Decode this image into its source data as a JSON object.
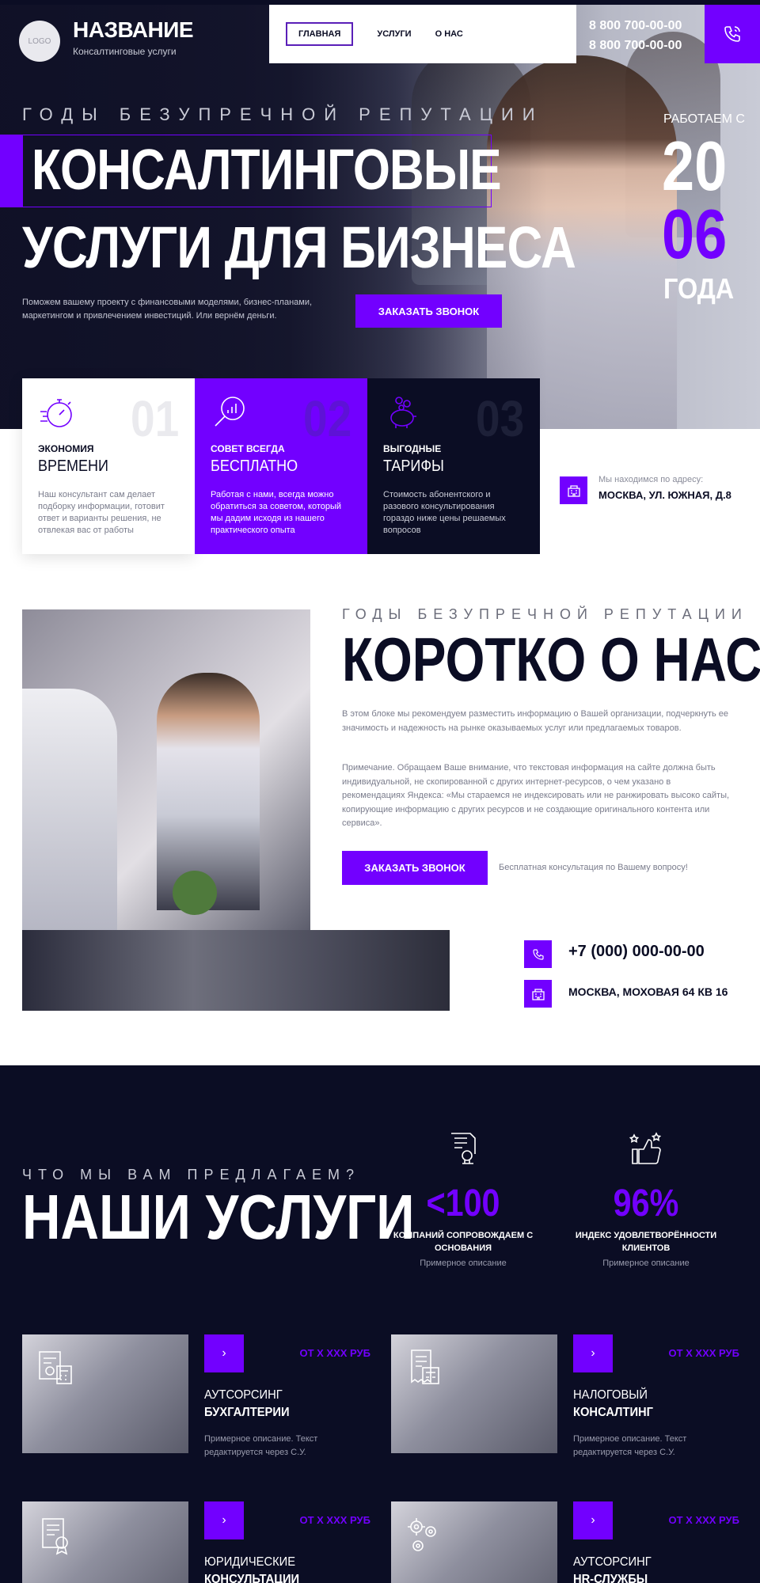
{
  "header": {
    "logo_text": "LOGO",
    "brand_name": "НАЗВАНИЕ",
    "brand_sub": "Консалтинговые услуги",
    "nav": [
      "ГЛАВНАЯ",
      "УСЛУГИ",
      "О НАС"
    ],
    "phone1": "8 800 700-00-00",
    "phone2": "8 800 700-00-00"
  },
  "hero": {
    "tagline": "ГОДЫ БЕЗУПРЕЧНОЙ РЕПУТАЦИИ",
    "headline1": "КОНСАЛТИНГОВЫЕ",
    "headline2": "УСЛУГИ ДЛЯ БИЗНЕСА",
    "description": "Поможем вашему проекту с финансовыми моделями, бизнес-планами, маркетингом и привлечением инвестиций. Или вернём деньги.",
    "cta": "ЗАКАЗАТЬ ЗВОНОК",
    "since_label": "РАБОТАЕМ С",
    "since_year_1": "20",
    "since_year_2": "06",
    "since_word": "ГОДА"
  },
  "features": [
    {
      "num": "01",
      "title1": "ЭКОНОМИЯ",
      "title2": "ВРЕМЕНИ",
      "text": "Наш консультант сам делает подборку информации, готовит ответ и варианты решения, не отвлекая вас от работы",
      "icon": "stopwatch-icon"
    },
    {
      "num": "02",
      "title1": "СОВЕТ ВСЕГДА",
      "title2": "БЕСПЛАТНО",
      "text": "Работая с нами, всегда можно обратиться за советом, который мы дадим исходя из нашего практического опыта",
      "icon": "magnifier-chart-icon"
    },
    {
      "num": "03",
      "title1": "ВЫГОДНЫЕ",
      "title2": "ТАРИФЫ",
      "text": "Стоимость абонентского и разового консультирования гораздо ниже цены решаемых вопросов",
      "icon": "piggy-bank-icon"
    }
  ],
  "address": {
    "label": "Мы находимся по адресу:",
    "value": "МОСКВА, УЛ. ЮЖНАЯ, Д.8"
  },
  "about": {
    "tagline": "ГОДЫ БЕЗУПРЕЧНОЙ РЕПУТАЦИИ",
    "title": "КОРОТКО О НАС",
    "p1": "В этом блоке мы рекомендуем разместить информацию о Вашей организации, подчеркнуть ее значимость и надежность на рынке оказываемых услуг или предлагаемых товаров.",
    "p2": "Примечание. Обращаем Ваше внимание, что текстовая информация на сайте должна быть индивидуальной, не скопированной с других интернет-ресурсов, о чем указано в рекомендациях Яндекса: «Мы стараемся не индексировать или не ранжировать высоко сайты, копирующие информацию с других ресурсов и не создающие оригинального контента или сервиса».",
    "cta": "ЗАКАЗАТЬ ЗВОНОК",
    "note": "Бесплатная консультация по Вашему вопросу!",
    "phone": "+7 (000) 000-00-00",
    "addr": "МОСКВА, МОХОВАЯ 64 КВ 16"
  },
  "services": {
    "tagline": "ЧТО МЫ ВАМ ПРЕДЛАГАЕМ?",
    "title": "НАШИ УСЛУГИ",
    "stats": [
      {
        "value": "<100",
        "label": "КОМПАНИЙ СОПРОВОЖДАЕМ С ОСНОВАНИЯ",
        "sub": "Примерное описание",
        "icon": "document-stamp-icon"
      },
      {
        "value": "96%",
        "label": "ИНДЕКС УДОВЛЕТВОРЁННОСТИ КЛИЕНТОВ",
        "sub": "Примерное описание",
        "icon": "thumbs-up-stars-icon"
      }
    ],
    "cards": [
      {
        "line1": "АУТСОРСИНГ",
        "line2": "БУХГАЛТЕРИИ",
        "desc": "Примерное описание. Текст редактируется через С.У.",
        "price": "ОТ Х ХХХ РУБ",
        "icon": "calculator-doc-icon"
      },
      {
        "line1": "НАЛОГОВЫЙ",
        "line2": "КОНСАЛТИНГ",
        "desc": "Примерное описание. Текст редактируется через С.У.",
        "price": "ОТ Х ХХХ РУБ",
        "icon": "receipt-icon"
      },
      {
        "line1": "ЮРИДИЧЕСКИЕ",
        "line2": "КОНСУЛЬТАЦИИ",
        "desc": "",
        "price": "ОТ Х ХХХ РУБ",
        "icon": "legal-doc-icon"
      },
      {
        "line1": "АУТСОРСИНГ",
        "line2": "HR-СЛУЖБЫ",
        "desc": "",
        "price": "ОТ Х ХХХ РУБ",
        "icon": "gears-people-icon"
      }
    ],
    "arrow": "›"
  },
  "colors": {
    "accent": "#7200ff",
    "dark": "#0b0d24",
    "muted": "#7a7c8c"
  }
}
